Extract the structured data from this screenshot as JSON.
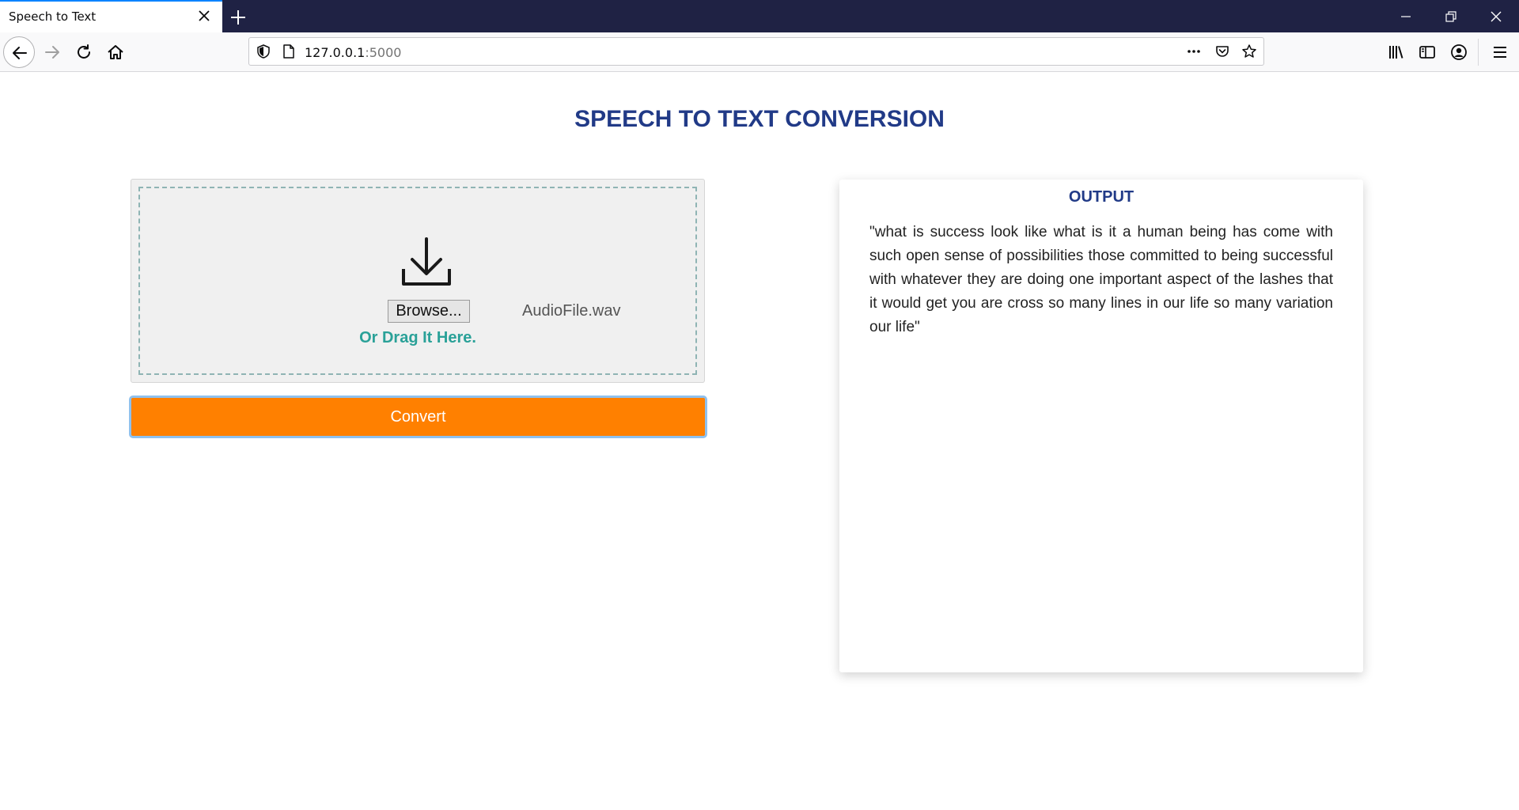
{
  "browser": {
    "tab_title": "Speech to Text",
    "url_host": "127.0.0.1",
    "url_port": ":5000"
  },
  "page": {
    "title": "SPEECH TO TEXT CONVERSION"
  },
  "upload": {
    "browse_label": "Browse...",
    "file_name": "AudioFile.wav",
    "drag_text": "Or Drag It Here."
  },
  "convert": {
    "label": "Convert",
    "color": "#ff8000"
  },
  "output": {
    "title": "OUTPUT",
    "text": "\"what is success look like what is it a human being has come with such open sense of possibilities those committed to being successful with whatever they are doing one important aspect of the lashes that it would get you are cross so many lines in our life so many variation our life\""
  },
  "icons": {
    "tab_close": "close-icon",
    "new_tab": "plus-icon",
    "back": "arrow-left-icon",
    "forward": "arrow-right-icon",
    "reload": "reload-icon",
    "home": "home-icon",
    "shield": "shield-icon",
    "page": "page-icon",
    "more": "more-icon",
    "pocket": "pocket-icon",
    "bookmark": "star-icon",
    "library": "library-icon",
    "sidebar": "sidebar-icon",
    "account": "account-icon",
    "menu": "hamburger-icon",
    "upload": "download-icon"
  },
  "colors": {
    "title": "#213a87",
    "drag_text": "#2aa198",
    "tabbar": "#1f2244"
  }
}
